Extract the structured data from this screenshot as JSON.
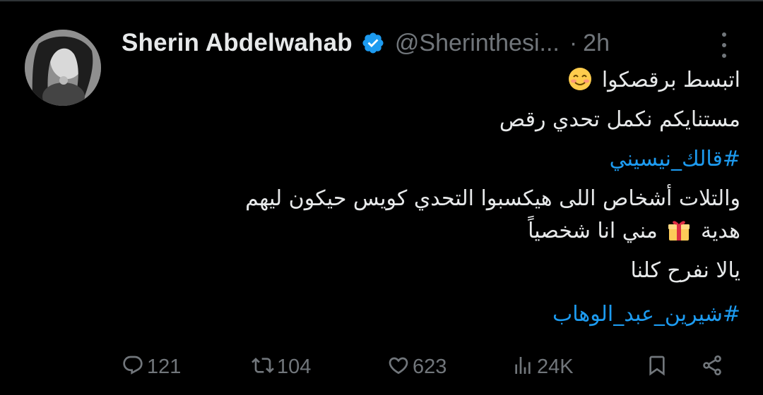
{
  "tweet": {
    "author": {
      "display_name": "Sherin Abdelwahab",
      "handle": "@Sherinthesi...",
      "verified": true
    },
    "time": "2h",
    "separator": "·",
    "lines": [
      {
        "text": "اتبسط برقصكوا",
        "emoji": "smiling-face",
        "hashtag": false
      },
      {
        "text": "مستنايكم نكمل تحدي رقص",
        "hashtag": false
      },
      {
        "text": "#قالك_نيسيني",
        "hashtag": true
      },
      {
        "text": "والتلات  أشخاص اللى هيكسبوا التحدي كويس حيكون ليهم",
        "hashtag": false
      },
      {
        "text_before": "هدية",
        "emoji": "gift",
        "text_after": "مني انا شخصياً",
        "hashtag": false
      },
      {
        "text": "يالا نفرح كلنا",
        "hashtag": false
      },
      {
        "text": "#شيرين_عبد_الوهاب",
        "hashtag": true
      }
    ]
  },
  "actions": {
    "replies": "121",
    "retweets": "104",
    "likes": "623",
    "views": "24K"
  },
  "icons": [
    "verified-badge-icon",
    "more-options-icon",
    "reply-icon",
    "retweet-icon",
    "like-icon",
    "views-icon",
    "bookmark-icon",
    "share-icon"
  ],
  "colors": {
    "background": "#000000",
    "text": "#e7e9ea",
    "muted": "#71767b",
    "link": "#1d9bf0",
    "verified": "#1d9bf0"
  }
}
